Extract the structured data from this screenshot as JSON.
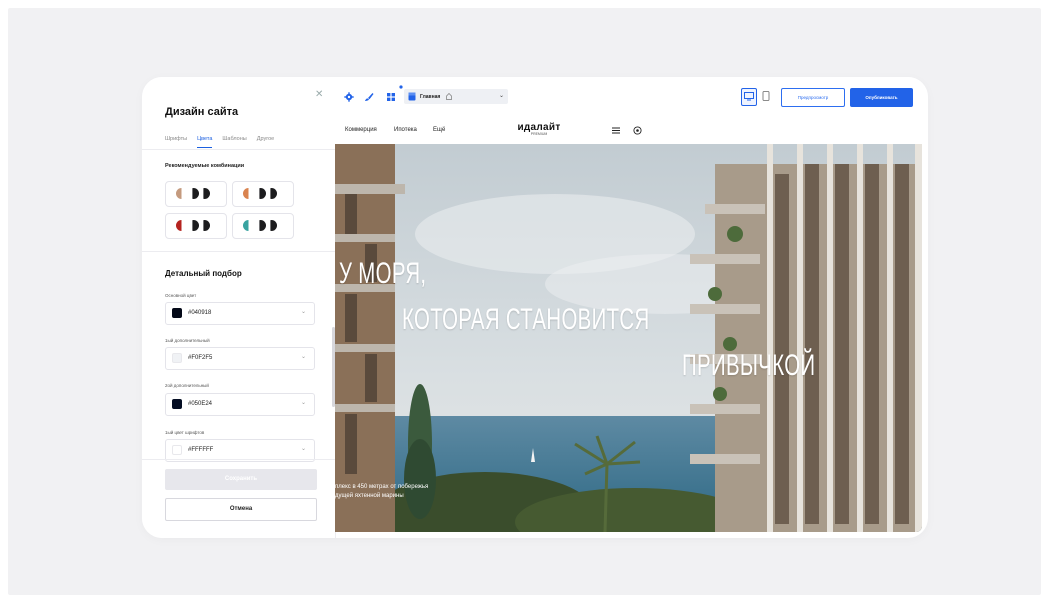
{
  "panel": {
    "title": "Дизайн сайта",
    "tabs": [
      "Шрифты",
      "Цвета",
      "Шаблоны",
      "Другое"
    ],
    "active_tab": "Цвета",
    "recommended_title": "Рекомендуемые комбинации",
    "combos": [
      {
        "colors": [
          "#c49a7e",
          "#1c1c1e",
          "#1c1c1e"
        ]
      },
      {
        "colors": [
          "#d9834f",
          "#1c1c1e",
          "#1c1c1e"
        ]
      },
      {
        "colors": [
          "#b5231f",
          "#1c1c1e",
          "#1c1c1e"
        ]
      },
      {
        "colors": [
          "#38a3a0",
          "#1c1c1e",
          "#1c1c1e"
        ]
      }
    ],
    "detail_title": "Детальный подбор",
    "fields": [
      {
        "label": "Основной цвет",
        "value": "#040918",
        "swatch": "#040918"
      },
      {
        "label": "1ый дополнительный",
        "value": "#F0F2F5",
        "swatch": "#F0F2F5"
      },
      {
        "label": "2ой дополнительный",
        "value": "#050E24",
        "swatch": "#050E24"
      },
      {
        "label": "1ый цвет шрифтов",
        "value": "#FFFFFF",
        "swatch": "#FFFFFF"
      }
    ],
    "save_label": "Сохранить",
    "cancel_label": "Отмена"
  },
  "toolbar": {
    "page_select_label": "Главная",
    "preview_label": "Предпросмотр",
    "publish_label": "Опубликовать"
  },
  "site": {
    "nav_links": [
      "Коммерция",
      "Ипотека",
      "Ещё"
    ],
    "logo_main": "идалайт",
    "logo_sub": "PREMIUM",
    "hero_lines": [
      "У МОРЯ,",
      "КОТОРАЯ СТАНОВИТСЯ",
      "ПРИВЫЧКОЙ"
    ],
    "hero_sub_lines": [
      "плекс в 450 метрах от побережья",
      "дущей яхтенной марины"
    ]
  },
  "colors": {
    "accent": "#2263e8",
    "sky": "#c9d3d9",
    "sea": "#3d7797"
  }
}
